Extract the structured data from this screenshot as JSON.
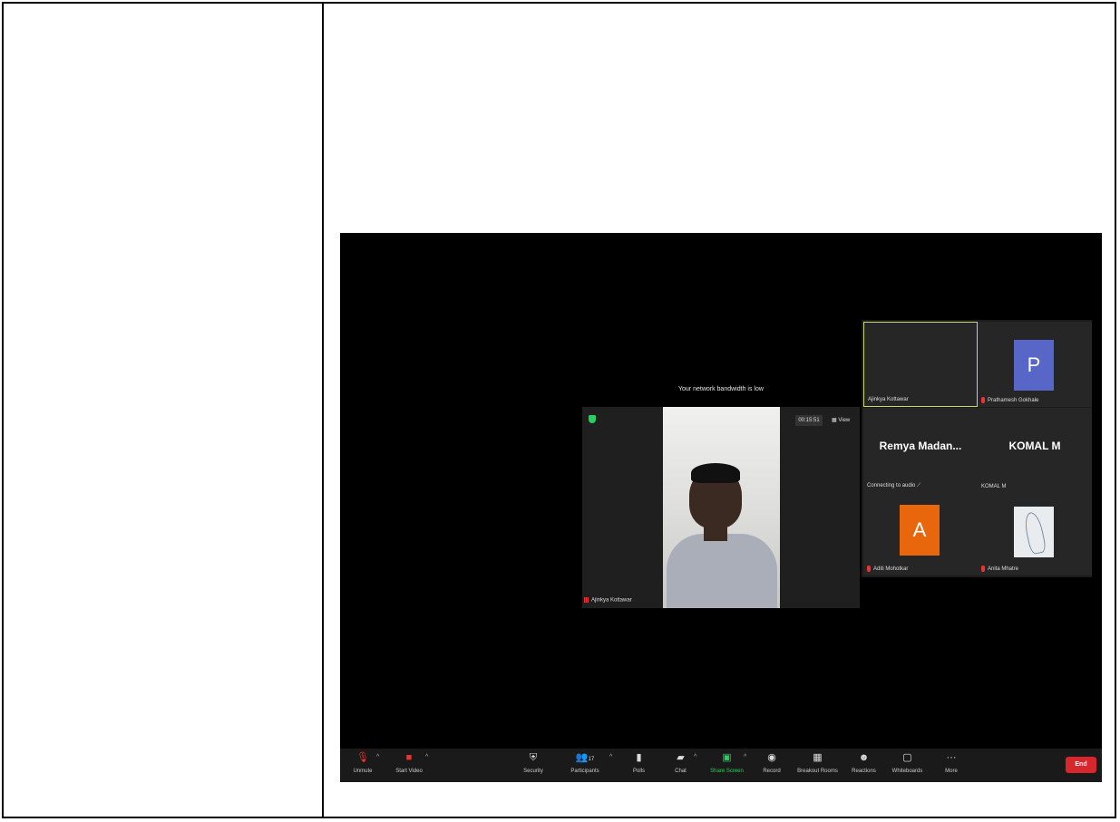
{
  "zoom": {
    "banner": "Your network bandwidth is low",
    "speaker": {
      "timer": "00:15:51",
      "view_label": "View",
      "name": "Ajinkya Kottawar"
    },
    "tiles": [
      {
        "name": "Ajinkya Kottawar",
        "avatar": "",
        "color": ""
      },
      {
        "name": "Prathamesh Gokhale",
        "avatar": "P",
        "color": "#5866c7"
      },
      {
        "name": "Connecting to audio",
        "display": "Remya  Madan..."
      },
      {
        "name": "KOMAL M",
        "display": "KOMAL M"
      },
      {
        "name": "Aditi Mohotkar",
        "avatar": "A",
        "color": "#e8670d"
      },
      {
        "name": "Anita Mhatre"
      }
    ],
    "toolbar": {
      "unmute": "Unmute",
      "start_video": "Start Video",
      "security": "Security",
      "participants": "Participants",
      "participants_count": "17",
      "polls": "Polls",
      "chat": "Chat",
      "share_screen": "Share Screen",
      "record": "Record",
      "breakout": "Breakout Rooms",
      "reactions": "Reactions",
      "whiteboards": "Whiteboards",
      "more": "More",
      "end": "End"
    }
  }
}
